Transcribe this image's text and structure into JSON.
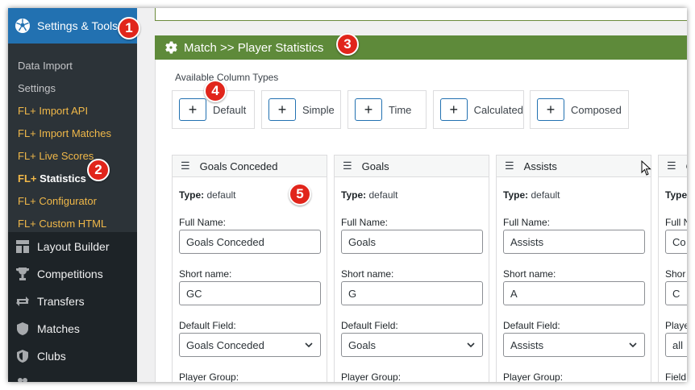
{
  "sidebar": {
    "active_item": {
      "label": "Settings & Tools",
      "icon": "soccer-ball-icon"
    },
    "submenu": [
      {
        "prefix": "",
        "label": "Data Import"
      },
      {
        "prefix": "",
        "label": "Settings"
      },
      {
        "prefix": "FL+",
        "label": "Import API"
      },
      {
        "prefix": "FL+",
        "label": "Import Matches"
      },
      {
        "prefix": "FL+",
        "label": "Live Scores"
      },
      {
        "prefix": "FL+",
        "label": "Statistics",
        "current": true
      },
      {
        "prefix": "FL+",
        "label": "Configurator"
      },
      {
        "prefix": "FL+",
        "label": "Custom HTML"
      }
    ],
    "menu": [
      {
        "label": "Layout Builder",
        "icon": "layout-icon"
      },
      {
        "label": "Competitions",
        "icon": "trophy-icon"
      },
      {
        "label": "Transfers",
        "icon": "transfer-arrows-icon"
      },
      {
        "label": "Matches",
        "icon": "shield-icon"
      },
      {
        "label": "Clubs",
        "icon": "club-shield-icon"
      }
    ]
  },
  "header": {
    "title": "Match >> Player Statistics",
    "icon": "gear-icon"
  },
  "column_types": {
    "label": "Available Column Types",
    "buttons": [
      {
        "label": "Default",
        "icon": "plus-icon"
      },
      {
        "label": "Simple",
        "icon": "plus-icon"
      },
      {
        "label": "Time",
        "icon": "plus-icon"
      },
      {
        "label": "Calculated",
        "icon": "plus-icon"
      },
      {
        "label": "Composed",
        "icon": "plus-icon"
      }
    ]
  },
  "columns": [
    {
      "name": "Goals Conceded",
      "type_label": "Type:",
      "type_value": "default",
      "full_name_label": "Full Name:",
      "full_name": "Goals Conceded",
      "short_name_label": "Short name:",
      "short_name": "GC",
      "default_field_label": "Default Field:",
      "default_field": "Goals Conceded",
      "player_group_label": "Player Group:"
    },
    {
      "name": "Goals",
      "type_label": "Type:",
      "type_value": "default",
      "full_name_label": "Full Name:",
      "full_name": "Goals",
      "short_name_label": "Short name:",
      "short_name": "G",
      "default_field_label": "Default Field:",
      "default_field": "Goals",
      "player_group_label": "Player Group:"
    },
    {
      "name": "Assists",
      "type_label": "Type:",
      "type_value": "default",
      "full_name_label": "Full Name:",
      "full_name": "Assists",
      "short_name_label": "Short name:",
      "short_name": "A",
      "default_field_label": "Default Field:",
      "default_field": "Assists",
      "player_group_label": "Player Group:"
    },
    {
      "name": "C",
      "type_label": "Type:",
      "type_value": "",
      "full_name_label": "Full N",
      "full_name": "Co",
      "short_name_label": "Shor",
      "short_name": "C",
      "default_field_label": "Playe",
      "default_field": "all",
      "player_group_label": "Field"
    }
  ],
  "badges": [
    "1",
    "2",
    "3",
    "4",
    "5"
  ],
  "colors": {
    "sidebar": "#1d2327",
    "active": "#2271b1",
    "header": "#5e8a3a",
    "badge": "#e1251b",
    "fl_accent": "#f0b849"
  }
}
